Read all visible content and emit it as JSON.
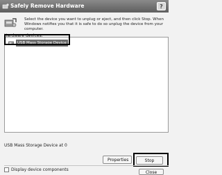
{
  "window": {
    "title": "Safely Remove Hardware",
    "help_label": "?"
  },
  "instructions": {
    "line1": "Select the device you want to unplug or eject, and then click Stop. When",
    "line2": "Windows notifies you that it is safe to do so unplug the device from your",
    "line3": "computer."
  },
  "hardware": {
    "label": "Hardware devices:",
    "items": [
      {
        "label": "USB Mass Storage Device",
        "icon": "usb-device-icon",
        "selected": true
      }
    ]
  },
  "status": {
    "device_location": "USB Mass Storage Device at 0"
  },
  "buttons": {
    "properties": "Properties",
    "stop": "Stop",
    "close": "Close"
  },
  "options": {
    "display_components_label": "Display device components",
    "display_components_checked": false
  }
}
